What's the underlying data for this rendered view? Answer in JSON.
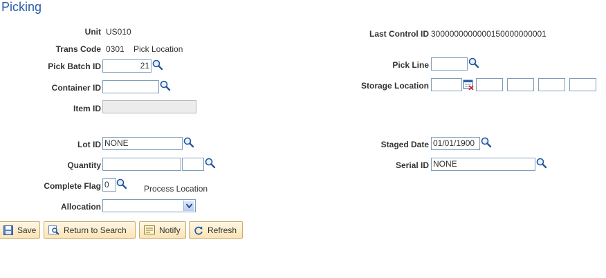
{
  "page": {
    "title": "Picking"
  },
  "fields": {
    "unit": {
      "label": "Unit",
      "value": "US010"
    },
    "trans_code": {
      "label": "Trans Code",
      "value": "0301",
      "description": "Pick Location"
    },
    "pick_batch_id": {
      "label": "Pick Batch ID",
      "value": "21"
    },
    "container_id": {
      "label": "Container ID",
      "value": ""
    },
    "item_id": {
      "label": "Item ID",
      "value": ""
    },
    "lot_id": {
      "label": "Lot ID",
      "value": "NONE"
    },
    "quantity": {
      "label": "Quantity",
      "value": "",
      "uom": ""
    },
    "complete_flag": {
      "label": "Complete Flag",
      "value": "0",
      "process_location": "Process Location"
    },
    "allocation": {
      "label": "Allocation",
      "value": ""
    },
    "last_control_id": {
      "label": "Last Control ID",
      "value": "3000000000000150000000001"
    },
    "pick_line": {
      "label": "Pick Line",
      "value": ""
    },
    "storage_location": {
      "label": "Storage Location",
      "values": [
        "",
        "",
        "",
        "",
        ""
      ]
    },
    "staged_date": {
      "label": "Staged Date",
      "value": "01/01/1900"
    },
    "serial_id": {
      "label": "Serial ID",
      "value": "NONE"
    }
  },
  "toolbar": {
    "save": "Save",
    "return_to_search": "Return to Search",
    "notify": "Notify",
    "refresh": "Refresh"
  },
  "icons": {
    "lookup": "magnifier-icon",
    "calendar": "calendar-icon",
    "dropdown": "chevron-down-icon"
  }
}
